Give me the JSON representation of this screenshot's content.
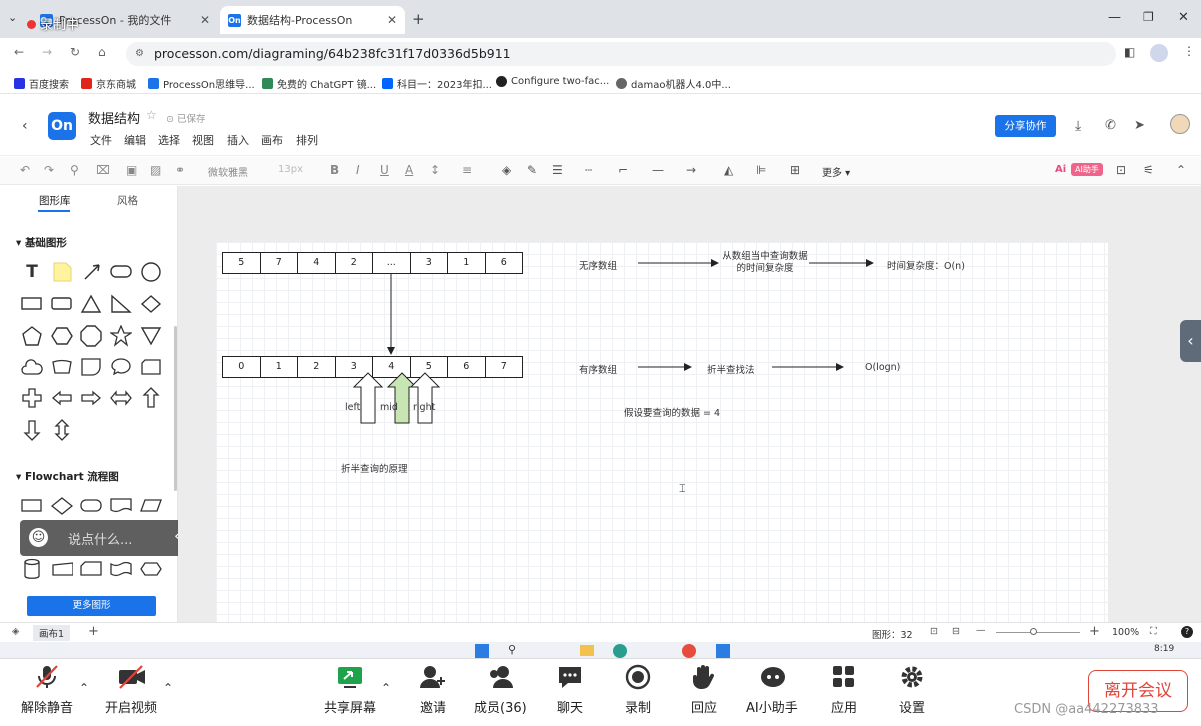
{
  "browser": {
    "tabs": [
      {
        "label": "ProcessOn - 我的文件",
        "icon": "On"
      },
      {
        "label": "数据结构-ProcessOn",
        "icon": "On"
      }
    ],
    "url": "processon.com/diagraming/64b238fc31f17d0336d5b911",
    "bookmarks": [
      "百度搜索",
      "京东商城",
      "ProcessOn思维导...",
      "免费的 ChatGPT 镜...",
      "科目一：2023年扣...",
      "Configure two-fac...",
      "damao机器人4.0中..."
    ]
  },
  "recording_badge": "录制中",
  "app": {
    "logo": "On",
    "title": "数据结构",
    "saved": "已保存",
    "menus": [
      "文件",
      "编辑",
      "选择",
      "视图",
      "插入",
      "画布",
      "排列"
    ],
    "share": "分享协作",
    "font": "微软雅黑",
    "font_size": "13px",
    "more": "更多",
    "ai": "AI助手"
  },
  "left_panel": {
    "tabs": [
      "图形库",
      "风格"
    ],
    "section_basic": "基础图形",
    "section_flow": "Flowchart 流程图",
    "more_shapes": "更多图形",
    "chat_placeholder": "说点什么..."
  },
  "diagram": {
    "top_row": [
      "5",
      "7",
      "4",
      "2",
      "...",
      "3",
      "1",
      "6"
    ],
    "bottom_row": [
      "0",
      "1",
      "2",
      "3",
      "4",
      "5",
      "6",
      "7"
    ],
    "arrow_labels": [
      "left",
      "mid",
      "right"
    ],
    "caption": "折半查询的原理",
    "unordered": "无序数组",
    "query": "从数组当中查询数据的时间复杂度",
    "complexity": "时间复杂度：O(n)",
    "ordered": "有序数组",
    "binary": "折半查找法",
    "logn": "O(logn)",
    "assume": "假设要查询的数据 = 4"
  },
  "status": {
    "page_tab": "画布1",
    "shapes": "图形：32",
    "zoom": "100%"
  },
  "taskbar": {
    "time": "8:19"
  },
  "meeting": {
    "buttons": [
      "解除静音",
      "开启视频",
      "共享屏幕",
      "邀请",
      "成员(36)",
      "聊天",
      "录制",
      "回应",
      "AI小助手",
      "应用",
      "设置"
    ],
    "leave": "离开会议",
    "watermark": "CSDN @aa442273833"
  },
  "colors": {
    "accent": "#1a73e8",
    "leave": "#e0453a",
    "mid_arrow": "#c8e6b4"
  }
}
